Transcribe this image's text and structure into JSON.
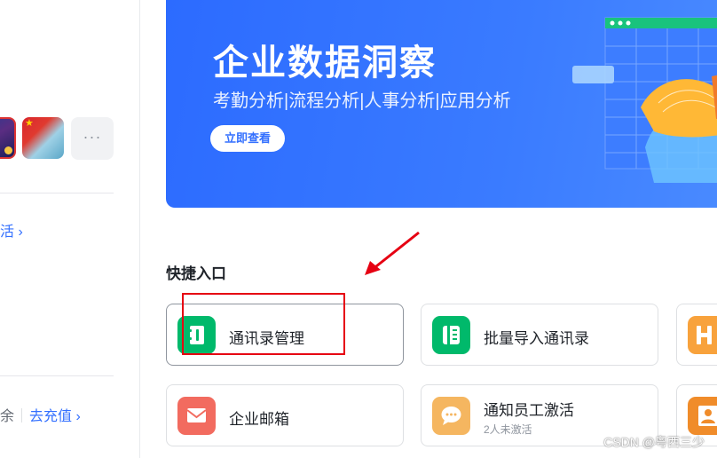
{
  "left_panel": {
    "apps": [
      {
        "name": "app-1"
      },
      {
        "name": "app-2"
      }
    ],
    "more_label": "···",
    "activate_text": "活 ›",
    "balance_text": "余",
    "recharge_text": "去充值 ›"
  },
  "banner": {
    "title": "企业数据洞察",
    "subtitle": "考勤分析|流程分析|人事分析|应用分析",
    "button_label": "立即查看"
  },
  "quick_entry": {
    "title": "快捷入口",
    "cards": [
      {
        "label": "通讯录管理",
        "icon": "contacts-icon",
        "color": "#00b96b"
      },
      {
        "label": "批量导入通讯录",
        "icon": "import-contacts-icon",
        "color": "#00b96b"
      },
      {
        "label": "企业邮箱",
        "icon": "mail-icon",
        "color": "#f26b5f"
      },
      {
        "label": "通知员工激活",
        "sublabel": "2人未激活",
        "icon": "chat-bubble-icon",
        "color": "#f5b660"
      }
    ],
    "partial_cards": [
      {
        "icon": "h-app-icon",
        "color": "#f8a23c"
      },
      {
        "icon": "person-icon",
        "color": "#f08c2a"
      }
    ]
  },
  "watermark": "CSDN @粤西三少"
}
